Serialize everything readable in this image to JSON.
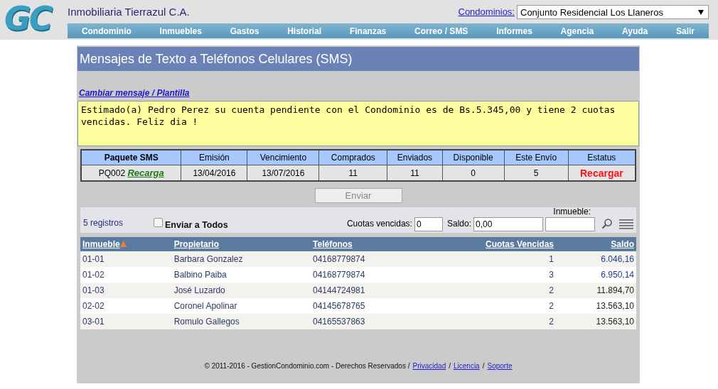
{
  "logo": "GC",
  "company": "Inmobiliaria Tierrazul C.A.",
  "condominio_selector": {
    "label": "Condominios:",
    "value": "Conjunto Residencial Los Llaneros"
  },
  "nav": [
    "Condominio",
    "Inmuebles",
    "Gastos",
    "Historial",
    "Finanzas",
    "Correo / SMS",
    "Informes",
    "Agencia",
    "Ayuda",
    "Salir"
  ],
  "page_title": "Mensajes de Texto a Teléfonos Celulares (SMS)",
  "template_link": "Cambiar mensaje / Plantilla",
  "message": "Estimado(a) Pedro Perez su cuenta pendiente con el Condominio es de Bs.5.345,00 y tiene 2 cuotas vencidas. Feliz dia !",
  "package_table": {
    "columns": [
      "Paquete SMS",
      "Emisión",
      "Vencimiento",
      "Comprados",
      "Enviados",
      "Disponible",
      "Este Envío",
      "Estatus"
    ],
    "row": {
      "package": "PQ002",
      "recharge_link": "Recarga",
      "issued": "13/04/2016",
      "expires": "13/07/2016",
      "bought": "11",
      "sent": "11",
      "available": "0",
      "this_send": "5",
      "status": "Recargar"
    }
  },
  "send_button": {
    "label": "Enviar",
    "disabled": true
  },
  "filters": {
    "count": "5 registros",
    "send_all": {
      "label": "Enviar a Todos",
      "checked": false
    },
    "overdue_label": "Cuotas vencidas:",
    "overdue_value": "0",
    "balance_label": "Saldo:",
    "balance_value": "0,00",
    "unit_label": "Inmueble:"
  },
  "table": {
    "columns": [
      {
        "label": "Inmueble",
        "sorted": true,
        "kind": "text"
      },
      {
        "label": "Propietario",
        "sorted": false,
        "kind": "text"
      },
      {
        "label": "Teléfonos",
        "sorted": false,
        "kind": "text"
      },
      {
        "label": "Cuotas Vencidas",
        "sorted": false,
        "kind": "number"
      },
      {
        "label": "Saldo",
        "sorted": false,
        "kind": "number"
      }
    ],
    "rows": [
      {
        "cells": [
          "01-01",
          "Barbara Gonzalez",
          "04168779874",
          "1",
          "6.046,16"
        ],
        "color": "#1f3f8f"
      },
      {
        "cells": [
          "01-02",
          "Balbino Paiba",
          "04168779874",
          "3",
          "6.950,14"
        ],
        "color": "#1f3f8f"
      },
      {
        "cells": [
          "01-03",
          "José Luzardo",
          "04144724981",
          "2",
          "11.894,70"
        ],
        "color": "#222222"
      },
      {
        "cells": [
          "02-02",
          "Coronel Apolinar",
          "04145678765",
          "2",
          "13.563,10"
        ],
        "color": "#222222"
      },
      {
        "cells": [
          "03-01",
          "Romulo Gallegos",
          "04165537863",
          "2",
          "13.563,10"
        ],
        "color": "#222222"
      }
    ]
  },
  "footer": {
    "text": "© 2011-2016 - GestionCondominio.com - Derechos Reservados /",
    "links": [
      "Privacidad",
      "Licencia",
      "Soporte"
    ],
    "separators": [
      "/",
      "/"
    ]
  }
}
